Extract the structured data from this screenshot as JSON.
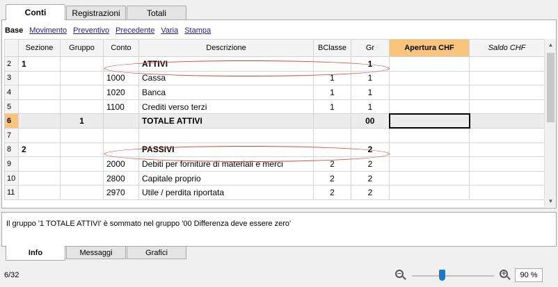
{
  "tabs_top": [
    {
      "label": "Conti",
      "active": true
    },
    {
      "label": "Registrazioni",
      "active": false
    },
    {
      "label": "Totali",
      "active": false
    }
  ],
  "views": {
    "current": "Base",
    "links": [
      "Movimento",
      "Preventivo",
      "Precedente",
      "Varia",
      "Stampa"
    ]
  },
  "table": {
    "columns": [
      "",
      "Sezione",
      "Gruppo",
      "Conto",
      "Descrizione",
      "BClasse",
      "Gr",
      "Apertura CHF",
      "Saldo CHF"
    ],
    "rows": [
      {
        "n": "2",
        "sezione": "1",
        "gruppo": "",
        "conto": "",
        "descrizione": "ATTIVI",
        "bclasse": "",
        "gr": "1",
        "apertura": "",
        "saldo": ""
      },
      {
        "n": "3",
        "sezione": "",
        "gruppo": "",
        "conto": "1000",
        "descrizione": "Cassa",
        "bclasse": "1",
        "gr": "1",
        "apertura": "",
        "saldo": ""
      },
      {
        "n": "4",
        "sezione": "",
        "gruppo": "",
        "conto": "1020",
        "descrizione": "Banca",
        "bclasse": "1",
        "gr": "1",
        "apertura": "",
        "saldo": ""
      },
      {
        "n": "5",
        "sezione": "",
        "gruppo": "",
        "conto": "1100",
        "descrizione": "Crediti verso terzi",
        "bclasse": "1",
        "gr": "1",
        "apertura": "",
        "saldo": ""
      },
      {
        "n": "6",
        "sezione": "",
        "gruppo": "1",
        "conto": "",
        "descrizione": "TOTALE ATTIVI",
        "bclasse": "",
        "gr": "00",
        "apertura": "",
        "saldo": ""
      },
      {
        "n": "7",
        "sezione": "",
        "gruppo": "",
        "conto": "",
        "descrizione": "",
        "bclasse": "",
        "gr": "",
        "apertura": "",
        "saldo": ""
      },
      {
        "n": "8",
        "sezione": "2",
        "gruppo": "",
        "conto": "",
        "descrizione": "PASSIVI",
        "bclasse": "",
        "gr": "2",
        "apertura": "",
        "saldo": ""
      },
      {
        "n": "9",
        "sezione": "",
        "gruppo": "",
        "conto": "2000",
        "descrizione": "Debiti per forniture di materiali e merci",
        "bclasse": "2",
        "gr": "2",
        "apertura": "",
        "saldo": ""
      },
      {
        "n": "10",
        "sezione": "",
        "gruppo": "",
        "conto": "2800",
        "descrizione": "Capitale proprio",
        "bclasse": "2",
        "gr": "2",
        "apertura": "",
        "saldo": ""
      },
      {
        "n": "11",
        "sezione": "",
        "gruppo": "",
        "conto": "2970",
        "descrizione": "Utile / perdita riportata",
        "bclasse": "2",
        "gr": "2",
        "apertura": "",
        "saldo": ""
      }
    ]
  },
  "info_message": "Il gruppo '1 TOTALE ATTIVI' è sommato nel gruppo '00 Differenza deve essere zero'",
  "tabs_bottom": [
    {
      "label": "Info",
      "active": true
    },
    {
      "label": "Messaggi",
      "active": false
    },
    {
      "label": "Grafici",
      "active": false
    }
  ],
  "status": "6/32",
  "zoom": {
    "value": "90 %",
    "level": 0.36
  }
}
